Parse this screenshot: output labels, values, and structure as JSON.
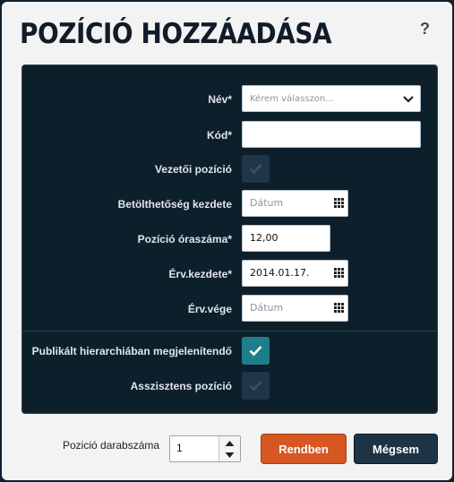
{
  "dialog": {
    "title": "POZÍCIÓ HOZZÁADÁSA",
    "help": "?"
  },
  "form": {
    "name": {
      "label": "Név*",
      "placeholder": "Kérem válasszon..."
    },
    "code": {
      "label": "Kód*",
      "value": ""
    },
    "manager": {
      "label": "Vezetői pozíció",
      "checked": false
    },
    "fill_start": {
      "label": "Betölthetőség kezdete",
      "placeholder": "Dátum"
    },
    "hours": {
      "label": "Pozíció óraszáma*",
      "value": "12,00"
    },
    "valid_from": {
      "label": "Érv.kezdete*",
      "value": "2014.01.17."
    },
    "valid_to": {
      "label": "Érv.vége",
      "placeholder": "Dátum"
    },
    "published": {
      "label": "Publikált hierarchiában megjelenítendő",
      "checked": true
    },
    "assistant": {
      "label": "Asszisztens pozíció",
      "checked": false
    }
  },
  "footer": {
    "count_label": "Pozició darabszáma",
    "count_value": "1",
    "ok_label": "Rendben",
    "cancel_label": "Mégsem"
  },
  "colors": {
    "panel": "#0e1f2c",
    "accent_checked": "#207d8a",
    "ok_button": "#d65722",
    "cancel_button": "#1d3446"
  }
}
